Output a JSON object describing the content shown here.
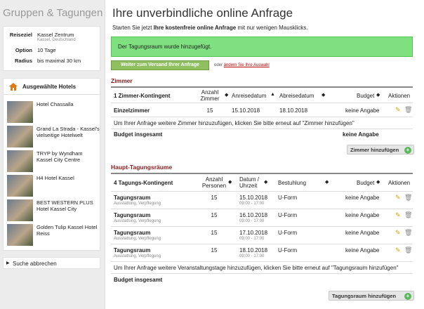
{
  "sidebar": {
    "title": "Gruppen & Tagungen",
    "search": [
      {
        "key": "Reiseziel",
        "value": "Kassel Zentrum",
        "sub": "Kassel, Deutschland"
      },
      {
        "key": "Option",
        "value": "10 Tage"
      },
      {
        "key": "Radius",
        "value": "bis maximal 30 km"
      }
    ],
    "hotels_title": "Ausgewählte Hotels",
    "hotels": [
      "Hotel Chassalla",
      "Grand La Strada - Kassel's vielseitige Hotelwelt",
      "TRYP by Wyndham Kassel City Centre",
      "H4 Hotel Kassel",
      "BEST WESTERN PLUS Hotel Kassel City",
      "Golden Tulip Kassel Hotel Reiss"
    ],
    "cancel": "Suche abbrechen"
  },
  "main": {
    "title": "Ihre unverbindliche online Anfrage",
    "intro_pre": "Starten Sie jetzt ",
    "intro_bold": "Ihre kostenfreie online Anfrage",
    "intro_post": " mit nur wenigen Mausklicks.",
    "message": "Der Tagungsraum wurde hinzugefügt.",
    "continue_button": "Weiter zum Versand Ihrer Anfrage",
    "or_text": "oder",
    "change_link": "ändern Sie Ihre Auswahl"
  },
  "zimmer": {
    "section": "Zimmer",
    "headers": {
      "kontingent": "1 Zimmer-Kontingent",
      "anzahl": "Anzahl Zimmer",
      "anreise": "Anreisedatum",
      "abreise": "Abreisedatum",
      "budget": "Budget",
      "aktionen": "Aktionen"
    },
    "rows": [
      {
        "name": "Einzelzimmer",
        "anzahl": "15",
        "anreise": "15.10.2018",
        "abreise": "18.10.2018",
        "budget": "keine Angabe"
      }
    ],
    "hint": "Um Ihrer Anfrage weitere Zimmer hinzuzufügen, klicken Sie bitte erneut auf \"Zimmer hinzufügen\"",
    "total_label": "Budget insgesamt",
    "total_value": "keine Angabe",
    "add_button": "Zimmer hinzufügen"
  },
  "raeume": {
    "section": "Haupt-Tagungsräume",
    "headers": {
      "kontingent": "4 Tagungs-Kontingent",
      "anzahl": "Anzahl Personen",
      "datum": "Datum / Uhrzeit",
      "bestuhlung": "Bestuhlung",
      "budget": "Budget",
      "aktionen": "Aktionen"
    },
    "rows": [
      {
        "name": "Tagungsraum",
        "sub": "Ausstattung, Verpflegung",
        "anzahl": "15",
        "datum": "15.10.2018",
        "zeit": "09:00 - 17:00",
        "bestuhlung": "U-Form",
        "budget": "keine Angabe"
      },
      {
        "name": "Tagungsraum",
        "sub": "Ausstattung, Verpflegung",
        "anzahl": "15",
        "datum": "16.10.2018",
        "zeit": "09:00 - 17:00",
        "bestuhlung": "U-Form",
        "budget": "keine Angabe"
      },
      {
        "name": "Tagungsraum",
        "sub": "Ausstattung, Verpflegung",
        "anzahl": "15",
        "datum": "17.10.2018",
        "zeit": "09:00 - 17:00",
        "bestuhlung": "U-Form",
        "budget": "keine Angabe"
      },
      {
        "name": "Tagungsraum",
        "sub": "Ausstattung, Verpflegung",
        "anzahl": "15",
        "datum": "18.10.2018",
        "zeit": "09:00 - 17:00",
        "bestuhlung": "U-Form",
        "budget": "keine Angabe"
      }
    ],
    "hint": "Um Ihrer Anfrage weitere Veranstaltungstage hinzuzufügen, klicken Sie bitte erneut auf \"Tagungsraum hinzufügen\"",
    "total_label": "Budget insgesamt",
    "add_button": "Tagungsraum hinzufügen"
  }
}
